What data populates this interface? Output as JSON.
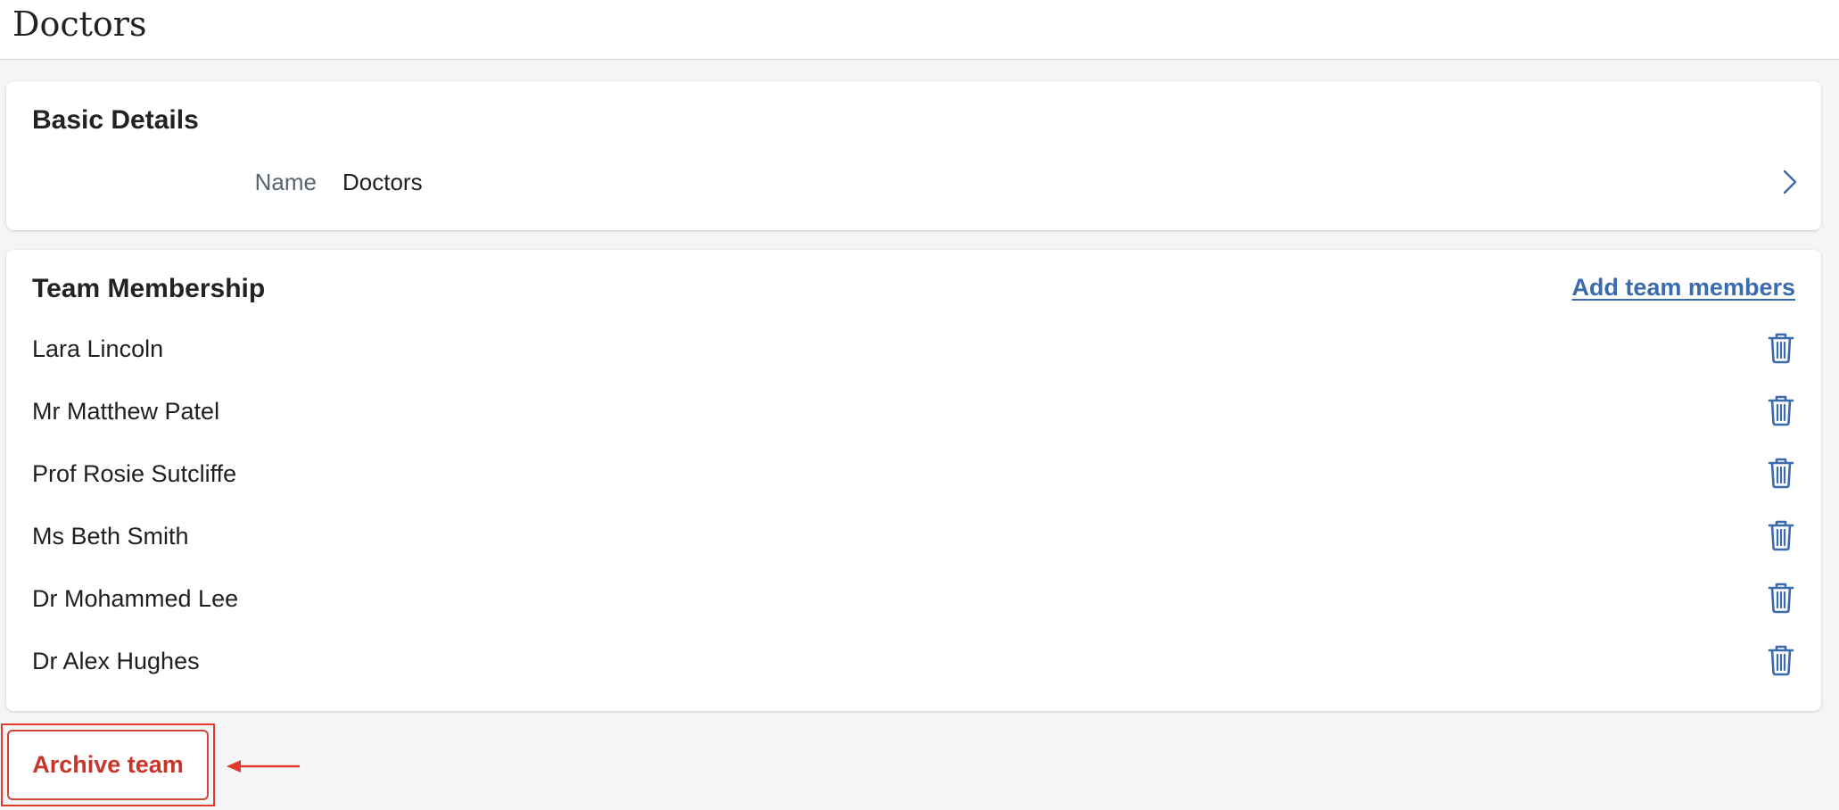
{
  "page": {
    "title": "Doctors"
  },
  "basic_details": {
    "heading": "Basic Details",
    "name_label": "Name",
    "name_value": "Doctors"
  },
  "team_membership": {
    "heading": "Team Membership",
    "add_link": "Add team members",
    "members": [
      "Lara Lincoln",
      "Mr Matthew Patel",
      "Prof Rosie Sutcliffe",
      "Ms Beth Smith",
      "Dr Mohammed Lee",
      "Dr Alex Hughes"
    ]
  },
  "actions": {
    "archive_label": "Archive team"
  },
  "icons": {
    "detail_chevron": "chevron-right-icon",
    "remove_member": "trash-icon",
    "annotation": "arrow-left-icon"
  },
  "colors": {
    "accent_blue": "#3b6bad",
    "danger_red": "#c8362a",
    "annotation_red": "#e23b2e",
    "page_background": "#f4f5f6"
  }
}
